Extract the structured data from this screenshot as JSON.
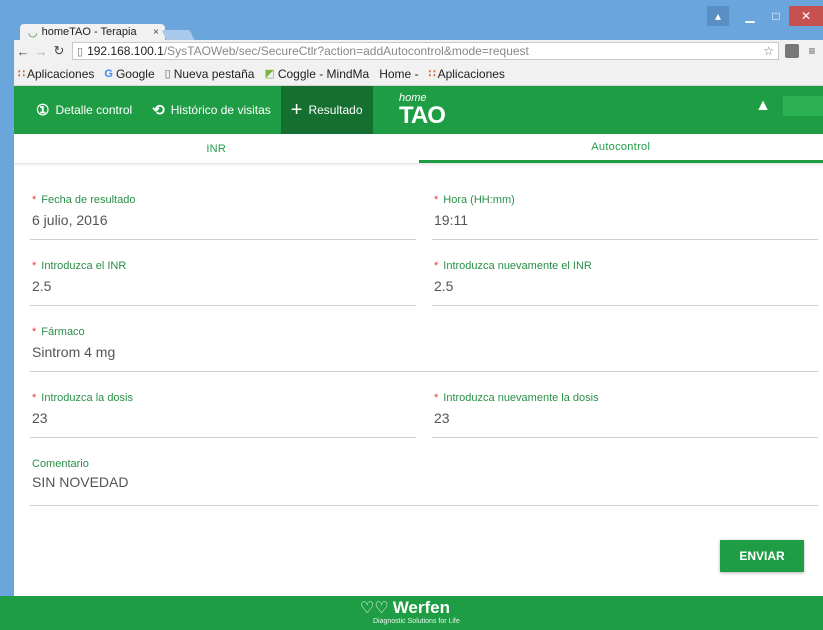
{
  "browser": {
    "tab_title": "homeTAO - Terapia",
    "tab_close": "×",
    "url_host": "192.168.100.1",
    "url_path": "/SysTAOWeb/sec/SecureCtlr?action=addAutocontrol&mode=request",
    "bookmarks": [
      {
        "icon": "apps-icon",
        "label": "Aplicaciones"
      },
      {
        "icon": "google-icon",
        "label": "Google"
      },
      {
        "icon": "page-icon",
        "label": "Nueva pestaña"
      },
      {
        "icon": "coggle-icon",
        "label": "Coggle - MindMa"
      },
      {
        "icon": "",
        "label": "Home -"
      },
      {
        "icon": "apps-icon",
        "label": "Aplicaciones"
      }
    ]
  },
  "nav": {
    "items": [
      {
        "icon": "clock-one-icon",
        "label": "Detalle control"
      },
      {
        "icon": "history-icon",
        "label": "Histórico de visitas"
      },
      {
        "icon": "plus-icon",
        "label": "Resultado"
      }
    ],
    "logo_small": "home",
    "logo_big": "TAO"
  },
  "tabs": [
    "INR",
    "Autocontrol"
  ],
  "form": {
    "fecha_label": "Fecha de resultado",
    "fecha_value": "6 julio, 2016",
    "hora_label": "Hora (HH:mm)",
    "hora_value": "19:11",
    "inr_label": "Introduzca el INR",
    "inr_value": "2.5",
    "inr2_label": "Introduzca nuevamente el INR",
    "inr2_value": "2.5",
    "farmaco_label": "Fármaco",
    "farmaco_value": "Sintrom 4 mg",
    "dosis_label": "Introduzca la dosis",
    "dosis_value": "23",
    "dosis2_label": "Introduzca nuevamente la dosis",
    "dosis2_value": "23",
    "comentario_label": "Comentario",
    "comentario_value": "SIN NOVEDAD",
    "required_mark": "*",
    "submit_label": "ENVIAR"
  },
  "footer": {
    "brand": "Werfen",
    "tagline": "Diagnostic Solutions for Life"
  },
  "colors": {
    "brand_green": "#1f9d45",
    "active_green": "#156f31",
    "required_red": "#e53935"
  }
}
